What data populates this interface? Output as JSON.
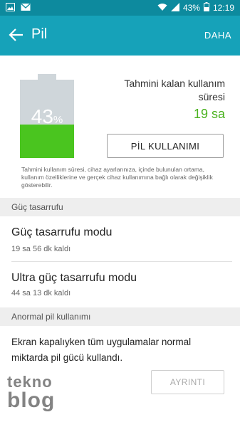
{
  "status_bar": {
    "battery": "43%",
    "time": "12:19",
    "icons": [
      "photo-icon",
      "email-icon",
      "wifi-icon",
      "signal-icon",
      "battery-icon"
    ]
  },
  "app_bar": {
    "title": "Pil",
    "more": "DAHA"
  },
  "battery": {
    "level_percent": 43,
    "percent_number": "43",
    "percent_sign": "%",
    "remaining_label": "Tahmini kalan kullanım süresi",
    "remaining_value": "19 sa",
    "usage_button": "PİL KULLANIMI",
    "disclaimer": "Tahmini kullanım süresi, cihaz ayarlarınıza, içinde bulunulan ortama, kullanım özelliklerine ve gerçek cihaz kullanımına bağlı olarak değişiklik gösterebilir.",
    "colors": {
      "fill": "#4ac51f",
      "empty": "#cfd6da",
      "value": "#4ab21f"
    }
  },
  "power_saving": {
    "header": "Güç tasarrufu",
    "items": [
      {
        "title": "Güç tasarrufu modu",
        "subtitle": "19 sa 56 dk kaldı"
      },
      {
        "title": "Ultra güç tasarrufu modu",
        "subtitle": "44 sa 13 dk kaldı"
      }
    ]
  },
  "abnormal": {
    "header": "Anormal pil kullanımı",
    "text": "Ekran kapalıyken tüm uygulamalar normal miktarda pil gücü kullandı.",
    "detail_button": "AYRINTI"
  },
  "watermark": {
    "line1": "tekno",
    "line2": "blog"
  },
  "colors": {
    "status_bar": "#0d8a9e",
    "app_bar": "#16a2b9"
  }
}
